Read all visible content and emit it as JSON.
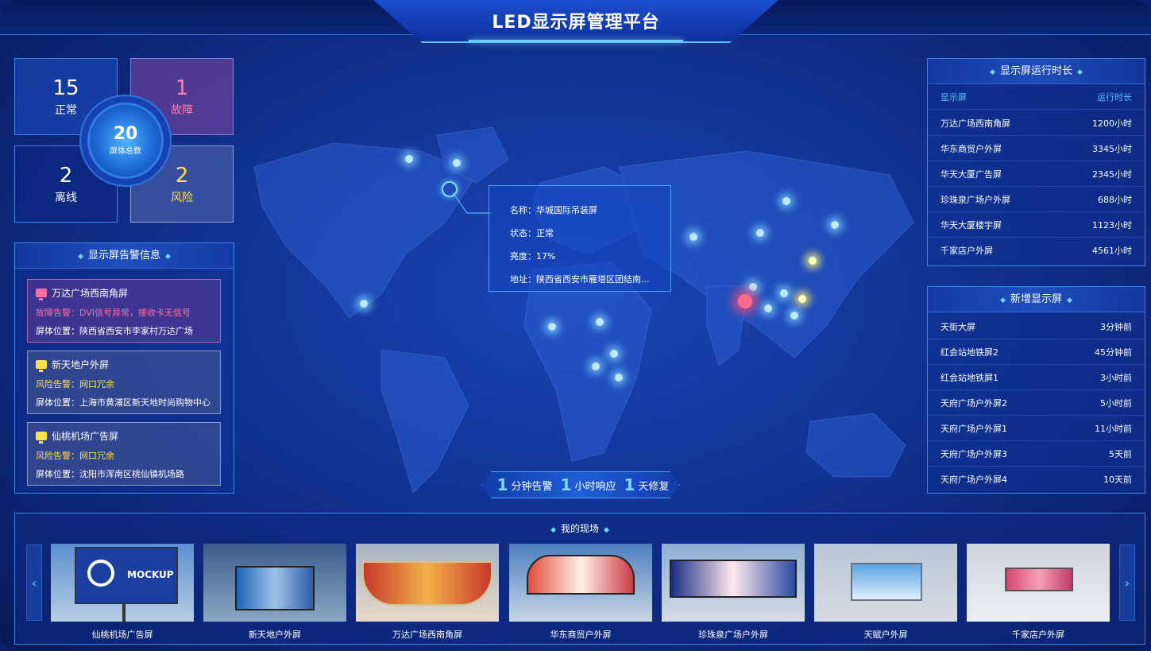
{
  "header": {
    "title": "LED显示屏管理平台"
  },
  "stats": {
    "normal": {
      "value": "15",
      "label": "正常"
    },
    "fault": {
      "value": "1",
      "label": "故障"
    },
    "offline": {
      "value": "2",
      "label": "离线"
    },
    "risk": {
      "value": "2",
      "label": "风险"
    },
    "total": {
      "value": "20",
      "label": "屏体总数"
    }
  },
  "alarms": {
    "title": "显示屏告警信息",
    "items": [
      {
        "name": "万达广场西南角屏",
        "alert": "故障告警：DVI信号异常，接收卡无信号",
        "location": "屏体位置：陕西省西安市李家村万达广场",
        "color": "#ff6fa0"
      },
      {
        "name": "新天地户外屏",
        "alert": "风险告警：网口冗余",
        "location": "屏体位置：上海市黄浦区新天地时尚购物中心",
        "color": "#ffe04a"
      },
      {
        "name": "仙桃机场广告屏",
        "alert": "风险告警：网口冗余",
        "location": "屏体位置：沈阳市浑南区桃仙镇机场路",
        "color": "#ffe04a"
      }
    ]
  },
  "popup": {
    "name": "名称：华城国际吊装屏",
    "status": "状态：正常",
    "brightness": "亮度：17%",
    "address": "地址：陕西省西安市雁塔区团结南..."
  },
  "slogan": {
    "n1": "1",
    "t1": "分钟告警",
    "n2": "1",
    "t2": "小时响应",
    "n3": "1",
    "t3": "天修复"
  },
  "runtime": {
    "title": "显示屏运行时长",
    "col1": "显示屏",
    "col2": "运行时长",
    "rows": [
      {
        "name": "万达广场西南角屏",
        "value": "1200小时"
      },
      {
        "name": "华东商贸户外屏",
        "value": "3345小时"
      },
      {
        "name": "华天大厦广告屏",
        "value": "2345小时"
      },
      {
        "name": "珍珠泉广场户外屏",
        "value": "688小时"
      },
      {
        "name": "华天大厦楼宇屏",
        "value": "1123小时"
      },
      {
        "name": "千家店户外屏",
        "value": "4561小时"
      }
    ]
  },
  "newscreens": {
    "title": "新增显示屏",
    "rows": [
      {
        "name": "天街大屏",
        "value": "3分钟前"
      },
      {
        "name": "红会站地铁屏2",
        "value": "45分钟前"
      },
      {
        "name": "红会站地铁屏1",
        "value": "3小时前"
      },
      {
        "name": "天府广场户外屏2",
        "value": "5小时前"
      },
      {
        "name": "天府广场户外屏1",
        "value": "11小时前"
      },
      {
        "name": "天府广场户外屏3",
        "value": "5天前"
      },
      {
        "name": "天府广场户外屏4",
        "value": "10天前"
      }
    ]
  },
  "gallery": {
    "title": "我的现场",
    "items": [
      "仙桃机场广告屏",
      "新天地户外屏",
      "万达广场西南角屏",
      "华东商贸户外屏",
      "珍珠泉广场户外屏",
      "天赋户外屏",
      "千家店户外屏"
    ],
    "mockup_text": "MOCKUP",
    "prev_icon": "chevron-left-icon",
    "next_icon": "chevron-right-icon"
  }
}
